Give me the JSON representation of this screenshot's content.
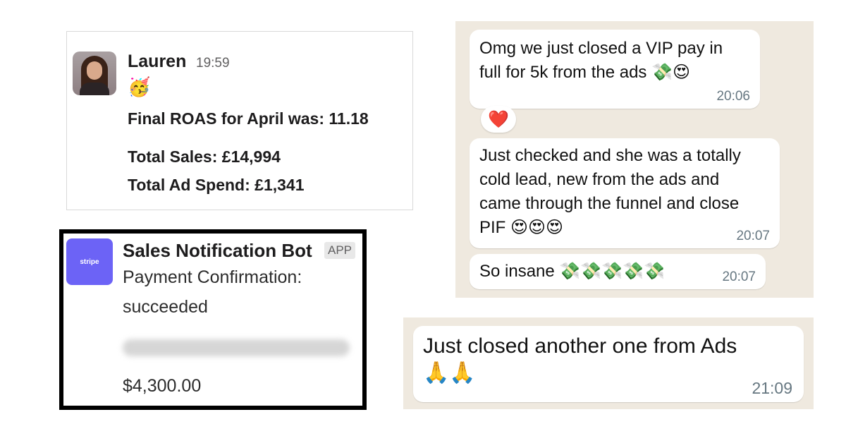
{
  "slack": {
    "name": "Lauren",
    "time": "19:59",
    "emoji": "🥳",
    "roas": "Final ROAS for April was: 11.18",
    "total_sales": "Total Sales: £14,994",
    "total_ad_spend": "Total Ad Spend: £1,341"
  },
  "bot": {
    "logo_text": "stripe",
    "name": "Sales Notification Bot",
    "badge": "APP",
    "message_line1": "Payment Confirmation:",
    "message_line2": "succeeded",
    "amount": "$4,300.00"
  },
  "whatsapp": {
    "messages": [
      {
        "line1": "Omg we just closed a VIP pay in",
        "line2": "full for 5k from the ads 💸😍",
        "time": "20:06"
      },
      {
        "line1": "Just checked and she was a totally",
        "line2": "cold lead, new from the ads and",
        "line3": "came through the funnel and close",
        "line4": "PIF 😍😍😍",
        "time": "20:07"
      },
      {
        "line1": "So insane 💸💸💸💸💸",
        "time": "20:07"
      }
    ],
    "reaction": "❤️"
  },
  "whatsapp2": {
    "line1": "Just closed another one from Ads",
    "line2": "🙏🙏",
    "time": "21:09"
  },
  "colors": {
    "stripe": "#6c63f6",
    "chat_bg": "#efe9df",
    "heart": "#e0242f"
  }
}
